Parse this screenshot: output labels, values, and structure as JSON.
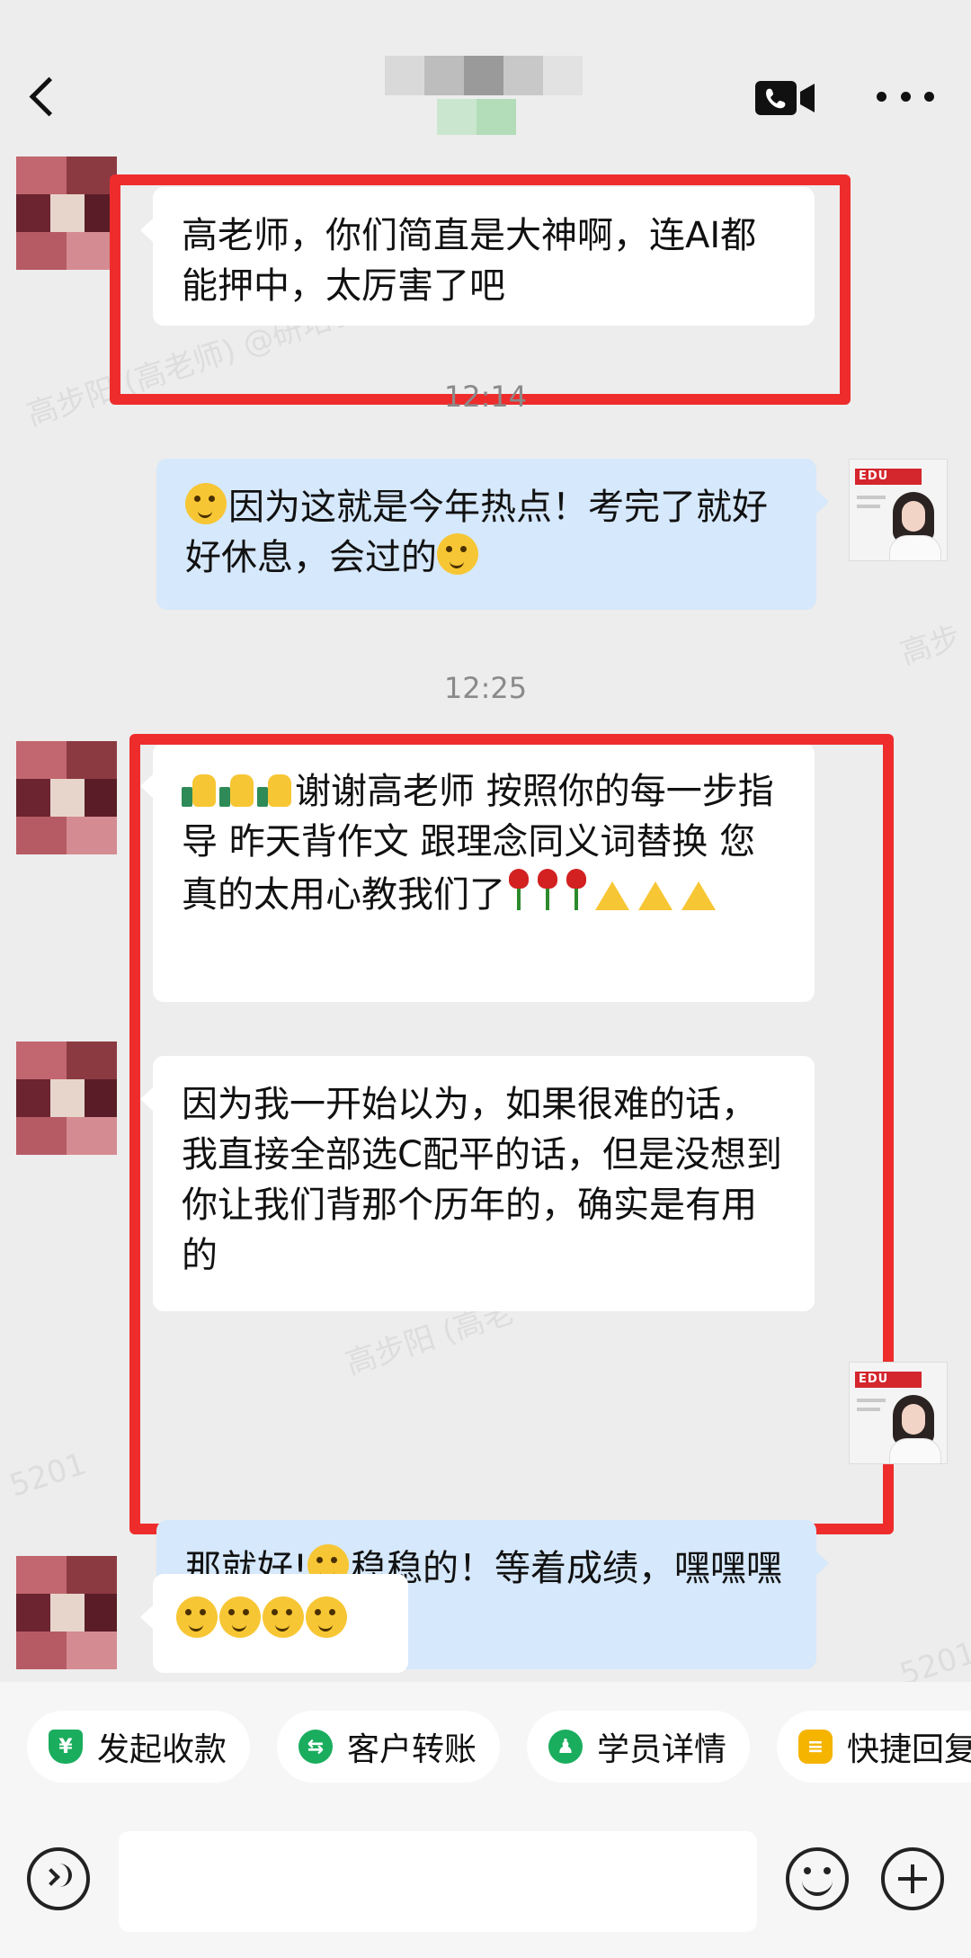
{
  "header": {
    "title": "",
    "back_icon": "chevron-left-icon",
    "video_icon": "video-call-icon",
    "more_icon": "more-dots-icon"
  },
  "watermarks": [
    "高步阳 (高老师) @研培教育",
    "高步阳 (高老",
    "高步",
    "5201",
    "5201"
  ],
  "messages": [
    {
      "id": "m1",
      "side": "left",
      "text": "高老师，你们简直是大神啊，连AI都能押中，太厉害了吧"
    },
    {
      "id": "t1",
      "type": "time",
      "text": "12:14"
    },
    {
      "id": "m2",
      "side": "right",
      "emoji_before": "smirk-face",
      "text": "因为这就是今年热点！考完了就好好休息，会过的",
      "emoji_after": "blush-face"
    },
    {
      "id": "t2",
      "type": "time",
      "text": "12:25"
    },
    {
      "id": "m3",
      "side": "left",
      "text": "谢谢高老师 按照你的每一步指导 昨天背作文 跟理念同义词替换 您真的太用心教我们了",
      "emoji_before": [
        "thumbs-up",
        "thumbs-up",
        "thumbs-up"
      ],
      "emoji_after": [
        "rose",
        "rose",
        "rose",
        "pray",
        "pray",
        "pray"
      ]
    },
    {
      "id": "m4",
      "side": "left",
      "text": "因为我一开始以为，如果很难的话，我直接全部选C配平的话，但是没想到你让我们背那个历年的，确实是有用的"
    },
    {
      "id": "m5",
      "side": "right",
      "text_part1": "那就好!",
      "emoji_mid": "smirk-face",
      "text_part2": "稳稳的！等着成绩，嘿嘿嘿"
    },
    {
      "id": "m6",
      "side": "left",
      "emojis": [
        "smirk-face",
        "smirk-face",
        "smirk-face",
        "smirk-face"
      ]
    }
  ],
  "quick_actions": [
    {
      "label": "发起收款",
      "icon": "shield-yen-icon",
      "color": "#1aad5e"
    },
    {
      "label": "客户转账",
      "icon": "transfer-icon",
      "color": "#1aad5e"
    },
    {
      "label": "学员详情",
      "icon": "student-icon",
      "color": "#1aad5e"
    },
    {
      "label": "快捷回复",
      "icon": "quick-reply-icon",
      "color": "#f5b400"
    }
  ],
  "input": {
    "value": "",
    "placeholder": ""
  },
  "colors": {
    "highlight_box": "#ee2c2c",
    "bubble_right": "#d6e8fb",
    "bubble_left": "#ffffff",
    "background": "#ededed"
  }
}
